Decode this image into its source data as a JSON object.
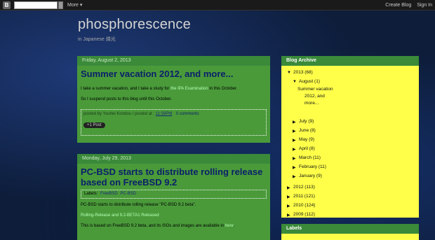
{
  "navbar": {
    "logo": "B",
    "more": "More ▾",
    "create_blog": "Create Blog",
    "sign_in": "Sign In"
  },
  "header": {
    "title": "phosphorescence",
    "description": "in Japanese  燐光"
  },
  "posts": [
    {
      "date": "Friday, August 2, 2013",
      "title": "Summer vacation 2012, and more...",
      "p1_a": "I take a summer vacation, and I take a study for ",
      "p1_link": "the IPA Examination",
      "p1_b": " in this October.",
      "p2": "So I suspend posts to this blog until this October.",
      "footer_posted": "posted by Youhei Kondou / posted at :",
      "footer_time": "11:59PM",
      "footer_comments": "0 comments",
      "share": "+1 Post"
    },
    {
      "date": "Monday, July 29, 2013",
      "title": "PC-BSD starts to distribute rolling release based on FreeBSD 9.2",
      "labels_prefix": "Labels:",
      "labels": [
        "FreeBSD",
        "PC-BSD"
      ],
      "p1": "PC-BSD starts to distribute rolling release \"PC-BSD 9.2 beta\".",
      "p2": "Rolling-Release and 9.2-BETA1 Released",
      "p3_a": "This is based on FreeBSD 9.2 beta, and its ISOs and images are available in ",
      "p3_link": "here",
      "p3_b": "."
    }
  ],
  "archive": {
    "heading": "Blog Archive",
    "year_2013": "2013 (68)",
    "august": "August (1)",
    "august_post": [
      "Summer vacation",
      "2012, and",
      "more..."
    ],
    "months": [
      "July (9)",
      "June (8)",
      "May (9)",
      "April (8)",
      "March (11)",
      "February (11)",
      "January (9)"
    ],
    "years": [
      "2012 (113)",
      "2011 (121)",
      "2010 (124)",
      "2009 (112)"
    ]
  },
  "labels_widget": {
    "heading": "Labels"
  },
  "colors": {
    "post_green": "#4a9a3a",
    "header_green": "#3a8a3a",
    "sidebar_yellow": "#ffff4a",
    "title_blue": "#0a1f6a"
  }
}
